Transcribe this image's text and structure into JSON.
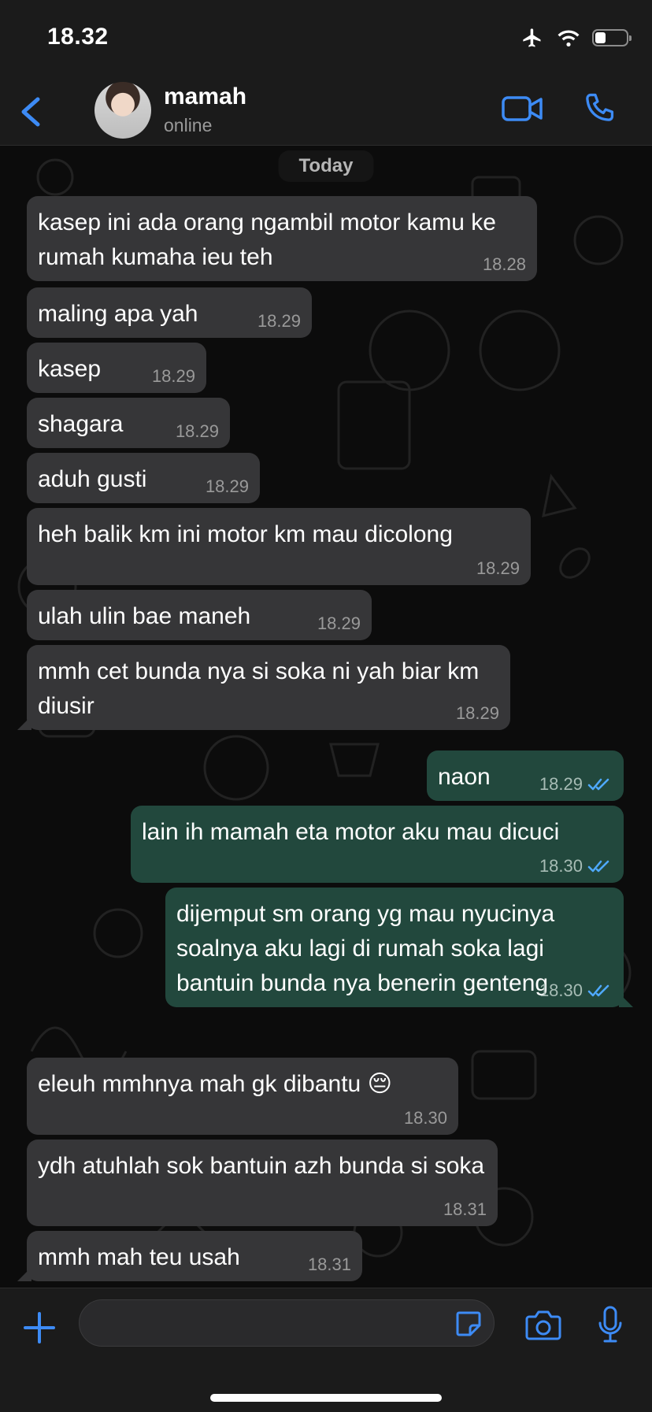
{
  "status_bar": {
    "time": "18.32"
  },
  "header": {
    "contact_name": "mamah",
    "contact_status": "online"
  },
  "chat": {
    "day_label": "Today",
    "messages": [
      {
        "dir": "in",
        "text": "kasep ini ada orang ngambil motor kamu ke rumah kumaha ieu teh",
        "time": "18.28"
      },
      {
        "dir": "in",
        "text": "maling apa yah",
        "time": "18.29"
      },
      {
        "dir": "in",
        "text": "kasep",
        "time": "18.29"
      },
      {
        "dir": "in",
        "text": "shagara",
        "time": "18.29"
      },
      {
        "dir": "in",
        "text": "aduh gusti",
        "time": "18.29"
      },
      {
        "dir": "in",
        "text": "heh balik km ini motor km mau dicolong",
        "time": "18.29"
      },
      {
        "dir": "in",
        "text": "ulah ulin bae maneh",
        "time": "18.29"
      },
      {
        "dir": "in",
        "text": "mmh cet bunda nya si soka ni yah biar km diusir",
        "time": "18.29"
      },
      {
        "dir": "out",
        "text": "naon",
        "time": "18.29"
      },
      {
        "dir": "out",
        "text": "lain ih mamah eta motor aku mau dicuci",
        "time": "18.30"
      },
      {
        "dir": "out",
        "text": "dijemput sm orang yg mau nyucinya soalnya aku lagi di rumah soka lagi bantuin bunda nya benerin genteng",
        "time": "18.30"
      },
      {
        "dir": "in",
        "text": "eleuh mmhnya mah gk dibantu 😔",
        "time": "18.30"
      },
      {
        "dir": "in",
        "text": "ydh atuhlah sok bantuin azh bunda si soka",
        "time": "18.31"
      },
      {
        "dir": "in",
        "text": "mmh mah teu usah",
        "time": "18.31"
      }
    ]
  },
  "icons": {
    "back": "chevron-left-icon",
    "video": "video-camera-icon",
    "call": "phone-icon",
    "plus": "plus-icon",
    "sticker": "sticker-icon",
    "camera": "camera-icon",
    "mic": "microphone-icon"
  },
  "colors": {
    "accent": "#3d8bf5",
    "incoming_bubble": "#363638",
    "outgoing_bubble": "#22483d",
    "read_tick": "#4fa9ff"
  }
}
